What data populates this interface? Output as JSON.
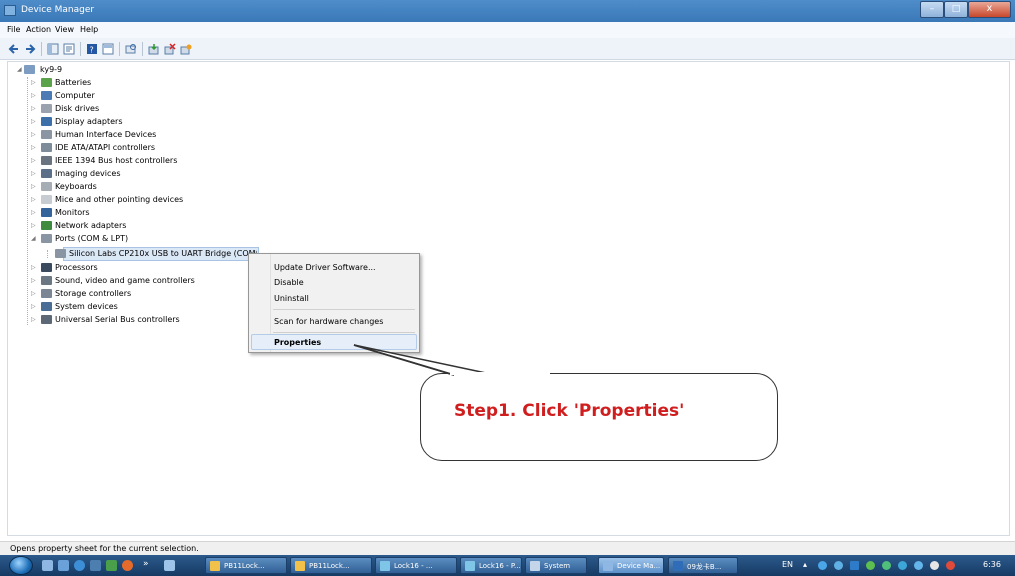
{
  "window": {
    "title": "Device Manager",
    "close_glyph": "x"
  },
  "menubar": {
    "items": [
      "File",
      "Action",
      "View",
      "Help"
    ]
  },
  "tree": {
    "root": "ky9-9",
    "items": [
      {
        "label": "Batteries",
        "icon": "battery-icon"
      },
      {
        "label": "Computer",
        "icon": "computer-icon"
      },
      {
        "label": "Disk drives",
        "icon": "disk-drive-icon"
      },
      {
        "label": "Display adapters",
        "icon": "display-adapter-icon"
      },
      {
        "label": "Human Interface Devices",
        "icon": "hid-icon"
      },
      {
        "label": "IDE ATA/ATAPI controllers",
        "icon": "ide-controller-icon"
      },
      {
        "label": "IEEE 1394 Bus host controllers",
        "icon": "ieee1394-icon"
      },
      {
        "label": "Imaging devices",
        "icon": "imaging-device-icon"
      },
      {
        "label": "Keyboards",
        "icon": "keyboard-icon"
      },
      {
        "label": "Mice and other pointing devices",
        "icon": "mouse-icon"
      },
      {
        "label": "Monitors",
        "icon": "monitor-icon"
      },
      {
        "label": "Network adapters",
        "icon": "network-adapter-icon"
      },
      {
        "label": "Ports (COM & LPT)",
        "icon": "port-icon"
      },
      {
        "label": "Silicon Labs CP210x USB to UART Bridge (COM**)",
        "icon": "port-icon"
      },
      {
        "label": "Processors",
        "icon": "processor-icon"
      },
      {
        "label": "Sound, video and game controllers",
        "icon": "sound-icon"
      },
      {
        "label": "Storage controllers",
        "icon": "storage-controller-icon"
      },
      {
        "label": "System devices",
        "icon": "system-device-icon"
      },
      {
        "label": "Universal Serial Bus controllers",
        "icon": "usb-icon"
      }
    ]
  },
  "context_menu": {
    "items": [
      "Update Driver Software...",
      "Disable",
      "Uninstall",
      "Scan for hardware changes",
      "Properties"
    ]
  },
  "callout": {
    "text": "Step1. Click 'Properties'"
  },
  "statusbar": {
    "text": "Opens property sheet for the current selection."
  },
  "taskbar": {
    "chevron": "»",
    "buttons": [
      "PB11Lock...",
      "PB11Lock...",
      "Lock16 - ...",
      "Lock16 - P...",
      "System",
      "Device Ma...",
      "09龙卡B..."
    ],
    "language": "EN",
    "time": "6:36"
  },
  "colors": {
    "accent_red": "#d01e1e",
    "titlebar_blue": "#3a78b8",
    "selection_blue": "#dbe8f6"
  }
}
